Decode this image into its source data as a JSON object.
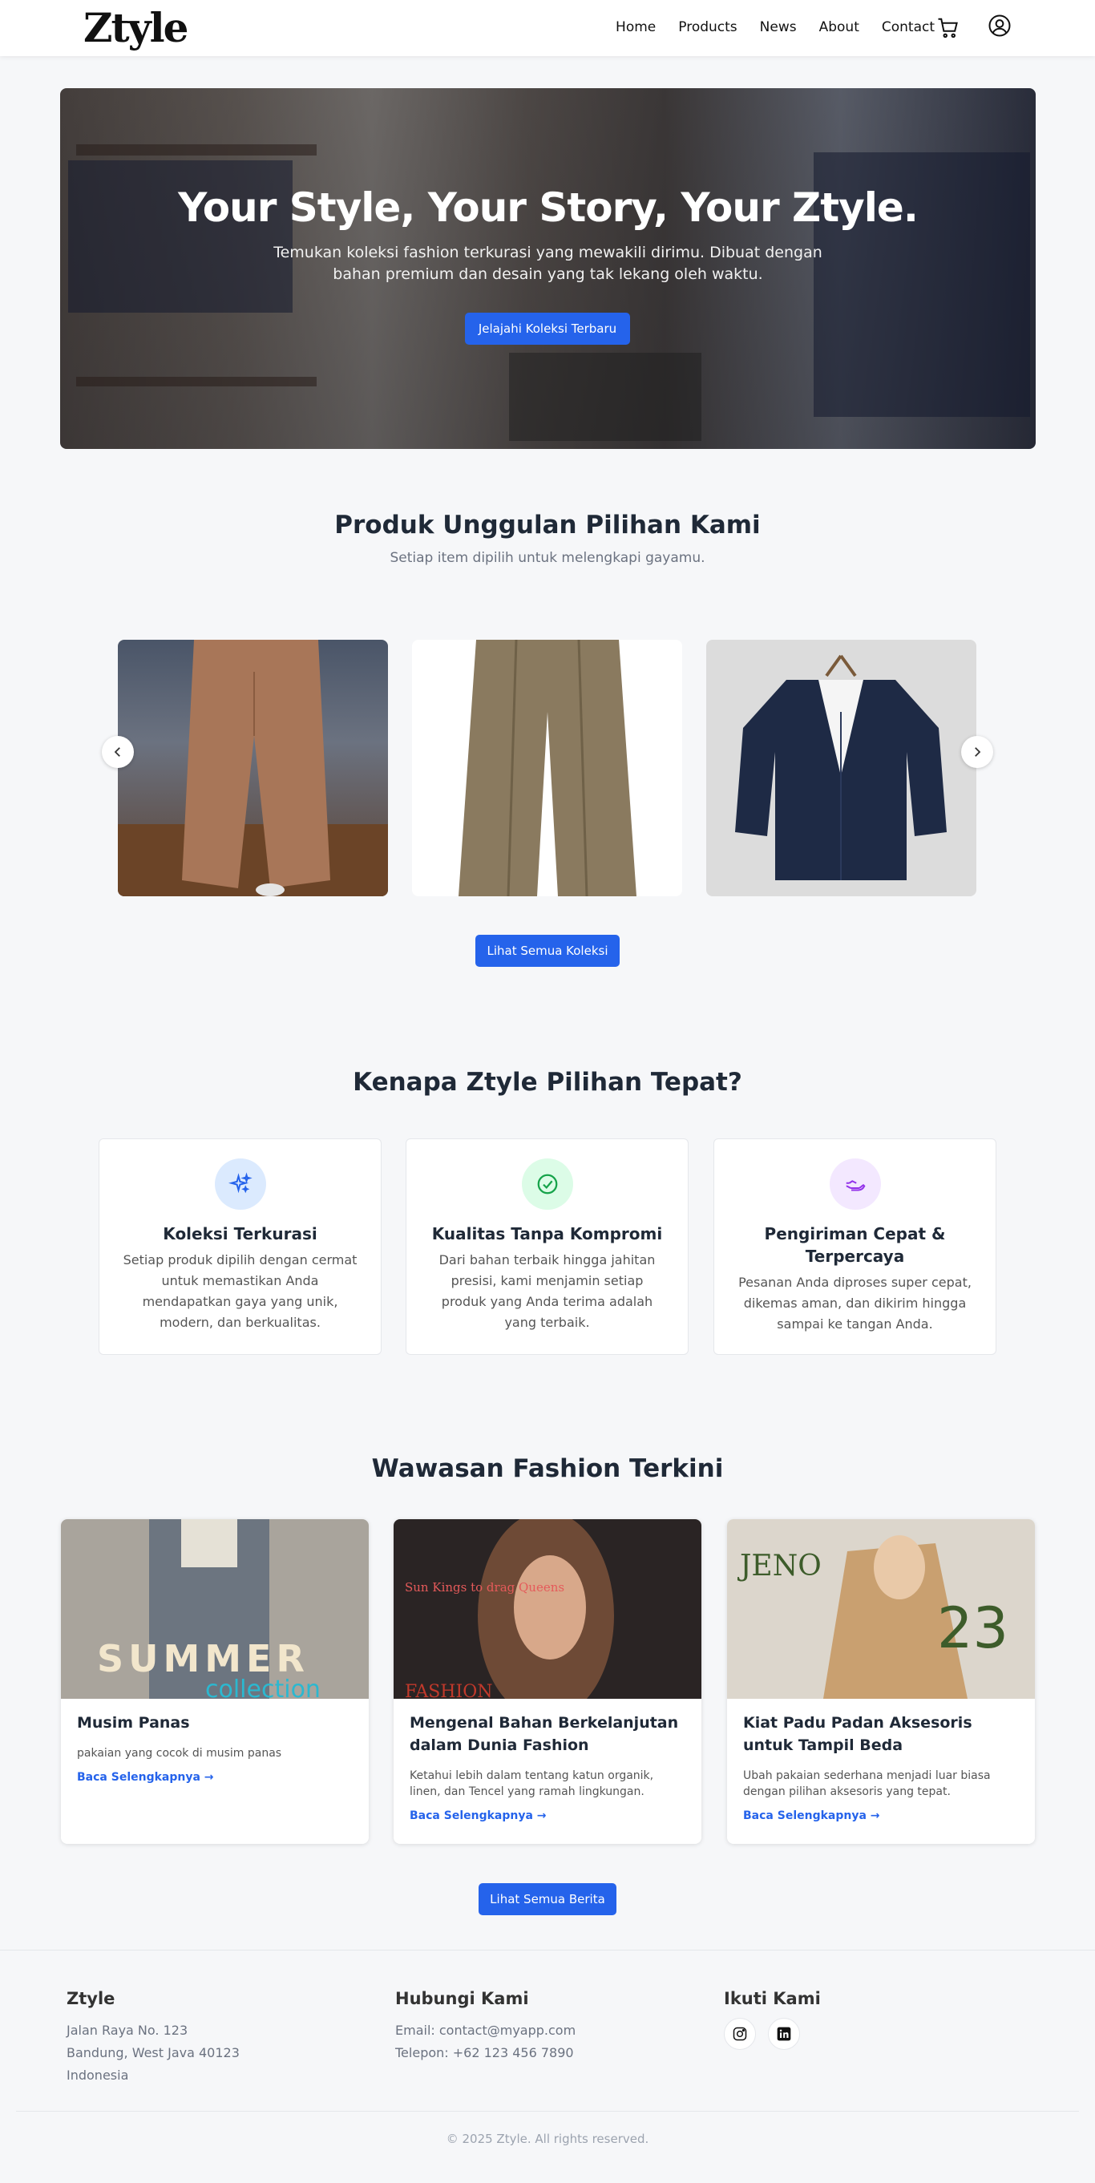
{
  "brand": {
    "logo": "Ztyle",
    "accent_color": "#2563eb"
  },
  "nav": {
    "links": [
      "Home",
      "Products",
      "News",
      "About",
      "Contact"
    ],
    "icons": [
      "cart-icon",
      "user-icon"
    ]
  },
  "hero": {
    "title": "Your Style, Your Story, Your Ztyle.",
    "subtitle": "Temukan koleksi fashion terkurasi yang mewakili dirimu. Dibuat dengan bahan premium dan desain yang tak lekang oleh waktu.",
    "button": "Jelajahi Koleksi Terbaru"
  },
  "featured": {
    "title": "Produk Unggulan Pilihan Kami",
    "subtitle": "Setiap item dipilih untuk melengkapi gayamu.",
    "button": "Lihat Semua Koleksi",
    "arrows": [
      "chevron-left-icon",
      "chevron-right-icon"
    ]
  },
  "why": {
    "title": "Kenapa Ztyle Pilihan Tepat?",
    "features": [
      {
        "title": "Koleksi Terkurasi",
        "desc": "Setiap produk dipilih dengan cermat untuk memastikan Anda mendapatkan gaya yang unik, modern, dan berkualitas.",
        "icon": "sparkles-icon",
        "color": "#2563eb",
        "bg": "#dbeafe"
      },
      {
        "title": "Kualitas Tanpa Kompromi",
        "desc": "Dari bahan terbaik hingga jahitan presisi, kami menjamin setiap produk yang Anda terima adalah yang terbaik.",
        "icon": "check-circle-icon",
        "color": "#16a34a",
        "bg": "#dcfce7"
      },
      {
        "title": "Pengiriman Cepat & Terpercaya",
        "desc": "Pesanan Anda diproses super cepat, dikemas aman, dan dikirim hingga sampai ke tangan Anda.",
        "icon": "delivery-icon",
        "color": "#9333ea",
        "bg": "#f3e8ff"
      }
    ]
  },
  "news": {
    "title": "Wawasan Fashion Terkini",
    "articles": [
      {
        "title": "Musim Panas",
        "desc": "pakaian yang cocok di musim panas",
        "link": "Baca Selengkapnya →",
        "cover_text": "SUMMER",
        "cover_sub": "collection"
      },
      {
        "title": "Mengenal Bahan Berkelanjutan dalam Dunia Fashion",
        "desc": "Ketahui lebih dalam tentang katun organik, linen, dan Tencel yang ramah lingkungan.",
        "link": "Baca Selengkapnya →",
        "cover_text": "FASHION",
        "cover_sub": "Sun Kings to drag Queens"
      },
      {
        "title": "Kiat Padu Padan Aksesoris untuk Tampil Beda",
        "desc": "Ubah pakaian sederhana menjadi luar biasa dengan pilihan aksesoris yang tepat.",
        "link": "Baca Selengkapnya →",
        "cover_text": "JENO",
        "cover_sub": "23"
      }
    ],
    "button": "Lihat Semua Berita"
  },
  "footer": {
    "brand": "Ztyle",
    "address": [
      "Jalan Raya No. 123",
      "Bandung, West Java 40123",
      "Indonesia"
    ],
    "contact_title": "Hubungi Kami",
    "contact": [
      "Email: contact@myapp.com",
      "Telepon: +62 123 456 7890"
    ],
    "follow_title": "Ikuti Kami",
    "social": [
      "instagram-icon",
      "linkedin-icon"
    ],
    "copyright": "© 2025 Ztyle. All rights reserved."
  }
}
